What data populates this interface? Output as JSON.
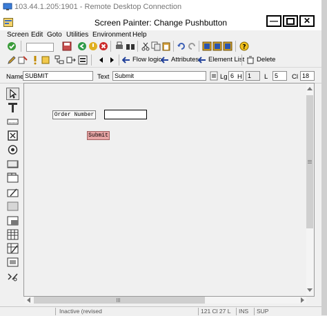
{
  "rdp": {
    "title": "103.44.1.205:1901 - Remote Desktop Connection"
  },
  "window": {
    "title": "Screen Painter:  Change Pushbutton"
  },
  "menu": [
    "Screen",
    "Edit",
    "Goto",
    "Utilities",
    "Environment",
    "Help"
  ],
  "toolbar2": {
    "flow_logic": "Flow logic",
    "attributes": "Attributes",
    "element_list": "Element List",
    "delete": "Delete"
  },
  "attributes": {
    "name_label": "Name",
    "name_value": "SUBMIT",
    "text_label": "Text",
    "text_value": "Submit",
    "lg_label": "Lg",
    "lg_value": "6",
    "h_label": "H",
    "h_value": "1",
    "l_label": "L",
    "l_value": "5",
    "cl_label": "Cl",
    "cl_value": "18"
  },
  "screen": {
    "label_text": "Order Number",
    "button_text": "Submit"
  },
  "status": {
    "mode": "Inactive (revised)",
    "pos": "121 Cl 27 L",
    "ins": "INS",
    "lang": "SUP"
  },
  "colors": {
    "button_fill": "#e8a5a5",
    "accent_red": "#c0392b",
    "accent_blue": "#1f5fbf"
  }
}
